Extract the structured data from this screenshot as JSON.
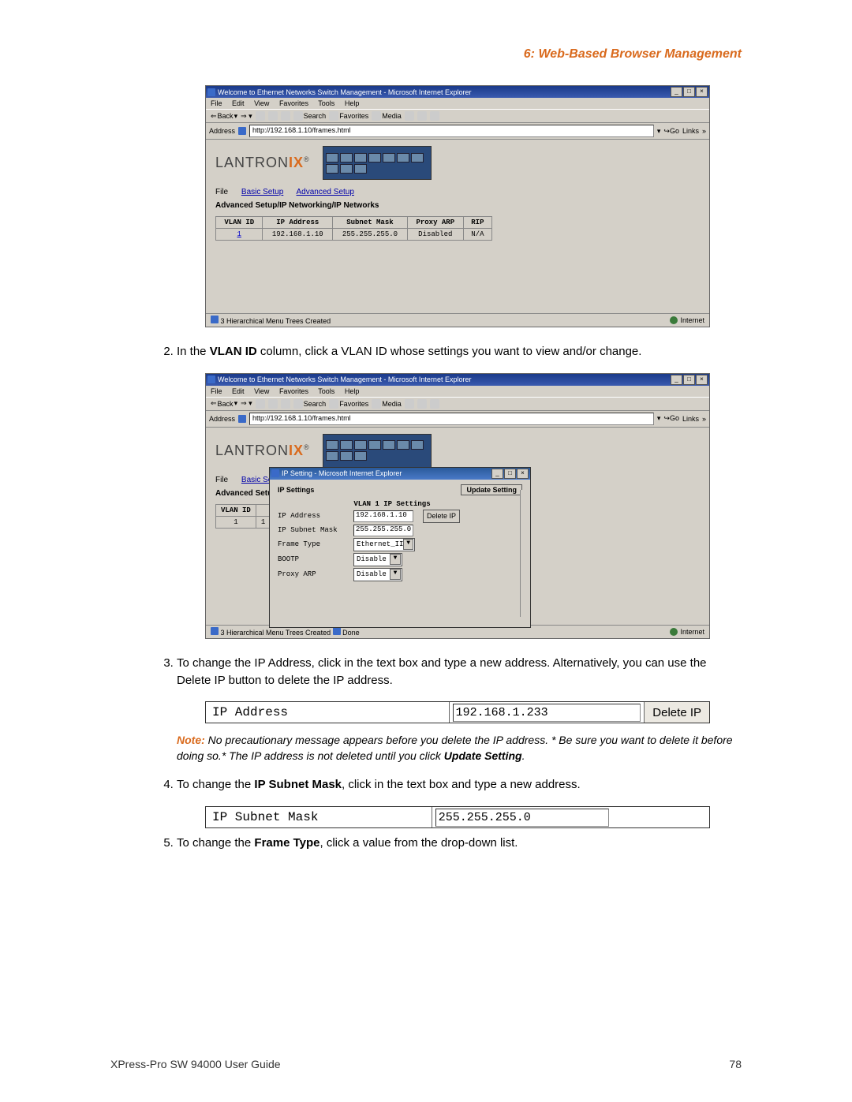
{
  "header": {
    "chapter": "6: Web-Based Browser Management"
  },
  "browser_common": {
    "title": "Welcome to Ethernet Networks Switch Management - Microsoft Internet Explorer",
    "menus": [
      "File",
      "Edit",
      "View",
      "Favorites",
      "Tools",
      "Help"
    ],
    "back": "Back",
    "search": "Search",
    "favorites": "Favorites",
    "media": "Media",
    "address_label": "Address",
    "url": "http://192.168.1.10/frames.html",
    "go": "Go",
    "links": "Links",
    "status_left": "3 Hierarchical Menu Trees Created",
    "zone": "Internet"
  },
  "shot1": {
    "brand_l": "LANTRON",
    "brand_ix": "IX",
    "app_menus": {
      "file": "File",
      "basic": "Basic Setup",
      "adv": "Advanced Setup"
    },
    "breadcrumb": "Advanced Setup/IP Networking/IP Networks",
    "th": [
      "VLAN ID",
      "IP Address",
      "Subnet Mask",
      "Proxy ARP",
      "RIP"
    ],
    "row": {
      "vlan": "1",
      "ip": "192.168.1.10",
      "mask": "255.255.255.0",
      "arp": "Disabled",
      "rip": "N/A"
    }
  },
  "step2": {
    "pre": "In the ",
    "b1": "VLAN ID",
    "post": " column, click a VLAN ID whose settings you want to view and/or change."
  },
  "shot2": {
    "breadcrumb": "Advanced Setup/IP Ne",
    "popup_title": "IP Setting - Microsoft Internet Explorer",
    "ipsettings": "IP Settings",
    "update": "Update Setting",
    "vlanhead": "VLAN 1 IP Settings",
    "rows": {
      "ipaddr_l": "IP Address",
      "ipaddr_v": "192.168.1.10",
      "delip": "Delete IP",
      "mask_l": "IP Subnet Mask",
      "mask_v": "255.255.255.0",
      "ft_l": "Frame Type",
      "ft_v": "Ethernet_II",
      "bootp_l": "BOOTP",
      "bootp_v": "Disable",
      "arp_l": "Proxy ARP",
      "arp_v": "Disable"
    },
    "th": [
      "VLAN ID"
    ],
    "row_vlan": "1",
    "done": "Done"
  },
  "step3": "To change the IP Address, click in the text box and type a new address. Alternatively, you can use the Delete IP button to delete the IP address.",
  "field_ip": {
    "label": "IP Address",
    "value": "192.168.1.233",
    "btn": "Delete IP"
  },
  "note": {
    "label": "Note:",
    "text": " No precautionary message appears before you delete the IP address. * Be sure you want to delete it before doing so.* The IP address is not deleted until you click ",
    "b": "Update Setting",
    "tail": "."
  },
  "step4": {
    "pre": "To change the ",
    "b": "IP Subnet Mask",
    "post": ", click in the text box and type a new address."
  },
  "field_mask": {
    "label": "IP Subnet Mask",
    "value": "255.255.255.0"
  },
  "step5": {
    "pre": "To change the ",
    "b": "Frame Type",
    "post": ", click a value from the drop-down list."
  },
  "footer": {
    "left": "XPress-Pro SW 94000 User Guide",
    "right": "78"
  }
}
